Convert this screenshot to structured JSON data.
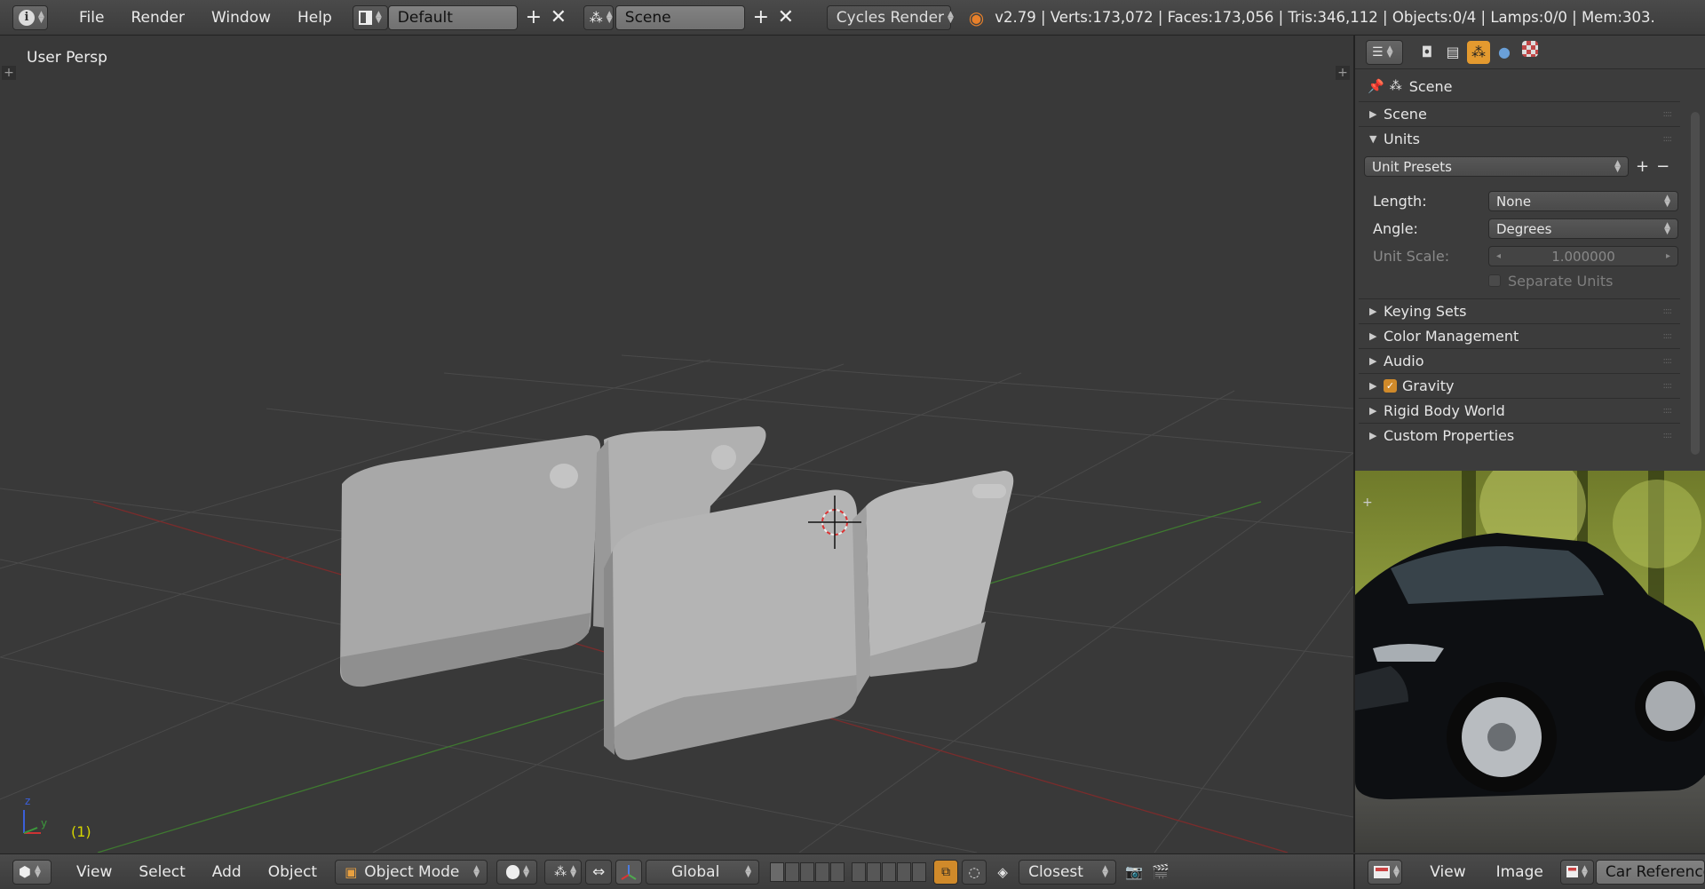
{
  "topbar": {
    "menus": [
      "File",
      "Render",
      "Window",
      "Help"
    ],
    "layout": "Default",
    "scene": "Scene",
    "render_engine": "Cycles Render",
    "stats": "v2.79 | Verts:173,072 | Faces:173,056 | Tris:346,112 | Objects:0/4 | Lamps:0/0 | Mem:303."
  },
  "viewport": {
    "view_name": "User Persp",
    "frame": "(1)",
    "axis_z": "z",
    "axis_y": "y"
  },
  "properties": {
    "breadcrumb": "Scene",
    "panels": {
      "scene": "Scene",
      "units": "Units",
      "unit_presets": "Unit Presets",
      "length_label": "Length:",
      "length_value": "None",
      "angle_label": "Angle:",
      "angle_value": "Degrees",
      "unit_scale_label": "Unit Scale:",
      "unit_scale_value": "1.000000",
      "separate_units": "Separate Units",
      "keying_sets": "Keying Sets",
      "color_management": "Color Management",
      "audio": "Audio",
      "gravity": "Gravity",
      "rigid_body_world": "Rigid Body World",
      "custom_properties": "Custom Properties"
    }
  },
  "bottombar": {
    "menus": [
      "View",
      "Select",
      "Add",
      "Object"
    ],
    "mode": "Object Mode",
    "orientation": "Global",
    "snap_target": "Closest"
  },
  "imagebar": {
    "menus": [
      "View",
      "Image"
    ],
    "image_name": "Car Reference.p"
  },
  "colors": {
    "accent": "#e49a2f",
    "frame_label": "#d6d600",
    "x_axis": "#8b2d2d",
    "y_axis": "#3d7a2e"
  }
}
